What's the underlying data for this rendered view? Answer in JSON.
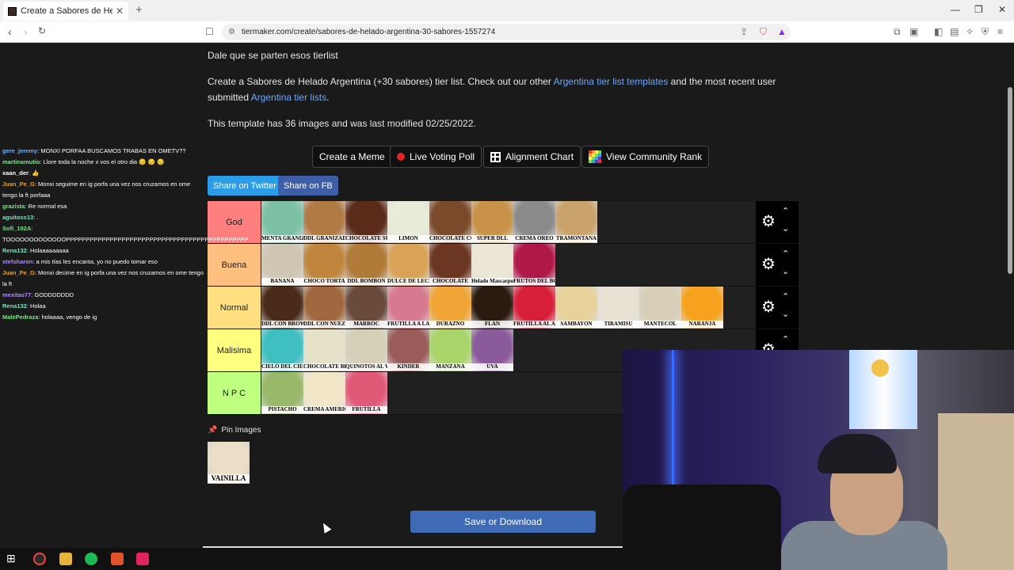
{
  "browser": {
    "tab_title": "Create a Sabores de Helado Argentina",
    "url": "tiermaker.com/create/sabores-de-helado-argentina-30-sabores-1557274"
  },
  "page": {
    "line1": "Dale que se parten esos tierlist",
    "intro_prefix": "Create a Sabores de Helado Argentina (+30 sabores) tier list. Check out our other ",
    "intro_link1": "Argentina tier list templates",
    "intro_mid": " and the most recent user submitted ",
    "intro_link2": "Argentina tier lists",
    "intro_suffix": ".",
    "template_info": "This template has 36 images and was last modified 02/25/2022.",
    "buttons": {
      "meme": "Create a Meme",
      "poll": "Live Voting Poll",
      "alignment": "Alignment Chart",
      "community": "View Community Rank"
    },
    "share_twitter": "Share on Twitter",
    "share_fb": "Share on FB",
    "pin_images": "Pin Images",
    "save": "Save or Download"
  },
  "tiers": [
    {
      "label": "God",
      "color": "#ff7f7f",
      "items": [
        {
          "cap": "MENTA GRANIZADA",
          "bg": "#7cc1a6"
        },
        {
          "cap": "DDL GRANIZADO",
          "bg": "#b07a45"
        },
        {
          "cap": "CHOCOLATE SUIZO",
          "bg": "#5b2b1a"
        },
        {
          "cap": "LIMON",
          "bg": "#e8ecd8"
        },
        {
          "cap": "CHOCOLATE CON ALMENDRAS",
          "bg": "#7a4a2a"
        },
        {
          "cap": "SUPER DLL",
          "bg": "#c89248"
        },
        {
          "cap": "CREMA OREO",
          "bg": "#8a8a8a"
        },
        {
          "cap": "TRAMONTANA",
          "bg": "#c9a26c"
        }
      ]
    },
    {
      "label": "Buena",
      "color": "#ffbf7f",
      "items": [
        {
          "cap": "BANANA",
          "bg": "#cfc6b3"
        },
        {
          "cap": "CHOCO TORTA",
          "bg": "#c0863e"
        },
        {
          "cap": "DDL BOMBON",
          "bg": "#b07a38"
        },
        {
          "cap": "DULCE DE LECHE",
          "bg": "#d9a257"
        },
        {
          "cap": "CHOCOLATE",
          "bg": "#6b3622"
        },
        {
          "cap": "Helado Mascarpone",
          "bg": "#ece6d6"
        },
        {
          "cap": "FRUTOS DEL BOSQUE",
          "bg": "#b01848"
        }
      ]
    },
    {
      "label": "Normal",
      "color": "#ffdf7f",
      "items": [
        {
          "cap": "DDL CON BROWNIE",
          "bg": "#4a2a18"
        },
        {
          "cap": "DDL CON NUEZ",
          "bg": "#a0683e"
        },
        {
          "cap": "MARROC",
          "bg": "#6a4a3a"
        },
        {
          "cap": "FRUTILLA A LA REINA",
          "bg": "#d77a8f"
        },
        {
          "cap": "DURAZNO",
          "bg": "#f0a536"
        },
        {
          "cap": "FLAN",
          "bg": "#2a1a10"
        },
        {
          "cap": "FRUTILLA AL AGUA",
          "bg": "#d81f3a"
        },
        {
          "cap": "SAMBAYON",
          "bg": "#e6d29a"
        },
        {
          "cap": "TIRAMISU",
          "bg": "#e8e2d4"
        },
        {
          "cap": "MANTECOL",
          "bg": "#d8cfb8"
        },
        {
          "cap": "NARANJA",
          "bg": "#f6a21e"
        }
      ]
    },
    {
      "label": "Malisima",
      "color": "#ffff7f",
      "items": [
        {
          "cap": "CIELO DEL CIELO",
          "bg": "#3fbfbf"
        },
        {
          "cap": "CHOCOLATE BLANCO",
          "bg": "#e6e2c8"
        },
        {
          "cap": "QUINOTOS AL WHISKY",
          "bg": "#d6cfb8"
        },
        {
          "cap": "KINDER",
          "bg": "#9a5c58"
        },
        {
          "cap": "MANZANA",
          "bg": "#a9d46a"
        },
        {
          "cap": "UVA",
          "bg": "#8a5a9a"
        }
      ]
    },
    {
      "label": "N P C",
      "color": "#bfff7f",
      "items": [
        {
          "cap": "PISTACHO",
          "bg": "#9ab86a"
        },
        {
          "cap": "CREMA AMERICANA",
          "bg": "#f2e6c8"
        },
        {
          "cap": "FRUTILLA",
          "bg": "#e05a78"
        }
      ]
    }
  ],
  "pinned": [
    {
      "cap": "VAINILLA",
      "bg": "#eadfc6"
    }
  ],
  "chat": [
    {
      "user": "gere_jeremy",
      "color": "#6ab0ff",
      "text": ": MONXI PORFAA BUSCAMOS TRABAS EN OMETV??"
    },
    {
      "user": "martinamutio",
      "color": "#7fe08a",
      "text": ": Llore toda la noche x vos el otro dia 😔 😔 😔"
    },
    {
      "user": "xaan_der",
      "color": "#ffffff",
      "text": ": 👍"
    },
    {
      "user": "Juan_Pe_G",
      "color": "#e0a030",
      "text": ": Monxi seguime en ig porfa una vez nos cruzamos en ome tengo la ft porfaaa"
    },
    {
      "user": "grazista",
      "color": "#7fe08a",
      "text": ": Re normal esa"
    },
    {
      "user": "aguitoss13",
      "color": "#7fe0c0",
      "text": ": ."
    },
    {
      "user": "Sofi_192A",
      "color": "#7fe08a",
      "text": ": TOOOOOOOOOOOOOPPPPPPPPPPPPPPPPPPPPPPPPPPPPPPPPPPPPPPPPPPPPPP"
    },
    {
      "user": "Rena132",
      "color": "#7fe0c0",
      "text": ": Holaaaaaaaaa"
    },
    {
      "user": "stefsharon",
      "color": "#b08aff",
      "text": ": a mis tías les encanta, yo no puedo tomar eso"
    },
    {
      "user": "Juan_Pe_G",
      "color": "#e0a030",
      "text": ": Monxi decime en ig porfa una vez nos cruzamos en ome tengo la ft"
    },
    {
      "user": "mexitas77",
      "color": "#b08aff",
      "text": ": GODDDDDDD"
    },
    {
      "user": "Rena132",
      "color": "#7fe0c0",
      "text": ": Holaa"
    },
    {
      "user": "MalePedraza",
      "color": "#7fe08a",
      "text": ": holaaaa, vengo de ig"
    }
  ]
}
